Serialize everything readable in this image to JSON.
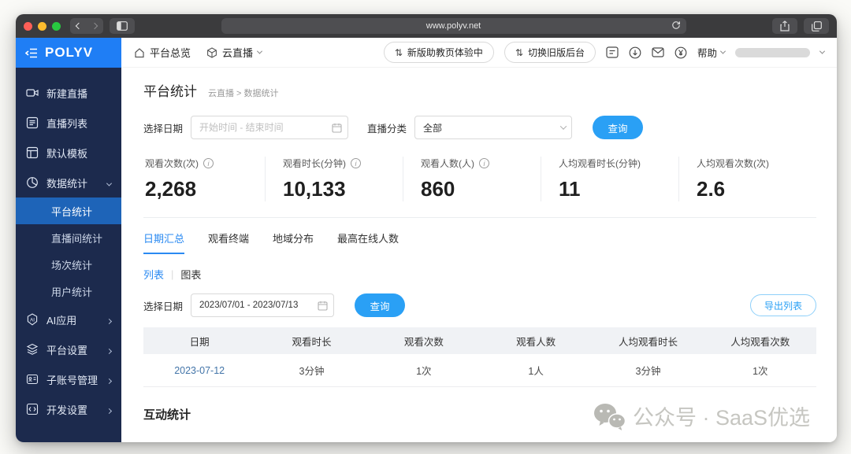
{
  "browser": {
    "url": "www.polyv.net",
    "traffic_lights": [
      "#ff5f57",
      "#febc2e",
      "#28c840"
    ]
  },
  "topbar": {
    "nav_overview": "平台总览",
    "nav_product": "云直播",
    "pill_new_assistant": "新版助教页体验中",
    "pill_switch_old": "切换旧版后台",
    "swap_icon": "⇅",
    "help": "帮助"
  },
  "sidebar": {
    "logo": "POLYV",
    "items": [
      {
        "label": "新建直播"
      },
      {
        "label": "直播列表"
      },
      {
        "label": "默认模板"
      },
      {
        "label": "数据统计"
      }
    ],
    "sub_items": [
      {
        "label": "平台统计"
      },
      {
        "label": "直播间统计"
      },
      {
        "label": "场次统计"
      },
      {
        "label": "用户统计"
      }
    ],
    "bottom_items": [
      {
        "label": "AI应用"
      },
      {
        "label": "平台设置"
      },
      {
        "label": "子账号管理"
      },
      {
        "label": "开发设置"
      }
    ]
  },
  "page": {
    "title": "平台统计",
    "breadcrumb": "云直播 > 数据统计"
  },
  "filters": {
    "date_label": "选择日期",
    "date_placeholder": "开始时间 - 结束时间",
    "category_label": "直播分类",
    "category_value": "全部",
    "query_label": "查询"
  },
  "stats": [
    {
      "label": "观看次数(次)",
      "value": "2,268"
    },
    {
      "label": "观看时长(分钟)",
      "value": "10,133"
    },
    {
      "label": "观看人数(人)",
      "value": "860"
    },
    {
      "label": "人均观看时长(分钟)",
      "value": "11"
    },
    {
      "label": "人均观看次数(次)",
      "value": "2.6"
    }
  ],
  "tabs": [
    {
      "label": "日期汇总"
    },
    {
      "label": "观看终端"
    },
    {
      "label": "地域分布"
    },
    {
      "label": "最高在线人数"
    }
  ],
  "view_toggle": {
    "list": "列表",
    "sep": "|",
    "chart": "图表"
  },
  "table_filters": {
    "date_label": "选择日期",
    "date_value": "2023/07/01 - 2023/07/13",
    "query_label": "查询",
    "export_label": "导出列表"
  },
  "table": {
    "headers": [
      "日期",
      "观看时长",
      "观看次数",
      "观看人数",
      "人均观看时长",
      "人均观看次数"
    ],
    "rows": [
      [
        "2023-07-12",
        "3分钟",
        "1次",
        "1人",
        "3分钟",
        "1次"
      ]
    ]
  },
  "section2_title": "互动统计",
  "watermark": "公众号 · SaaS优选",
  "colors": {
    "brand_blue": "#1f7ef5",
    "sidebar_navy": "#1c2a4d",
    "active_item_blue": "#1e64b8",
    "button_blue": "#2aa0f5",
    "tab_active_blue": "#2a8af2"
  }
}
